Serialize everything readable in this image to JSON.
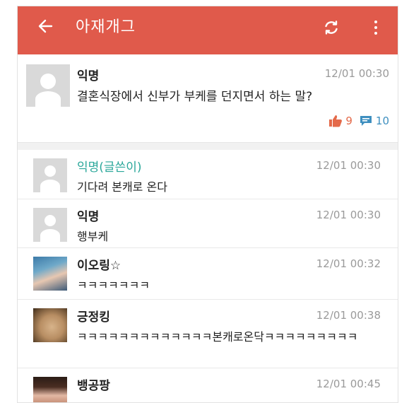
{
  "appbar": {
    "title": "아재개그",
    "icons": [
      "back-arrow-icon",
      "refresh-icon",
      "more-vertical-icon"
    ],
    "color": "#e05a4b"
  },
  "post": {
    "author": "익명",
    "time": "12/01 00:30",
    "body": "결혼식장에서 신부가 부케를 던지면서 하는 말?",
    "likes": "9",
    "comments": "10"
  },
  "comments": [
    {
      "author": "익명(글쓴이)",
      "time": "12/01 00:30",
      "text": "기다려 본캐로 온다"
    },
    {
      "author": "익명",
      "time": "12/01 00:30",
      "text": "행부케"
    },
    {
      "author": "이오링☆",
      "time": "12/01 00:32",
      "text": "ㅋㅋㅋㅋㅋㅋㅋ"
    },
    {
      "author": "긍정킹",
      "time": "12/01 00:38",
      "text": "ㅋㅋㅋㅋㅋㅋㅋㅋㅋㅋㅋㅋㅋ본캐로온닥ㅋㅋㅋㅋㅋㅋㅋㅋㅋ"
    },
    {
      "author": "뱅공팡",
      "time": "12/01 00:45",
      "text": ""
    }
  ],
  "colors": {
    "accent": "#e05a4b",
    "author_label": "#2aa79a",
    "like": "#e46a4a",
    "comment": "#3e8fbf"
  }
}
